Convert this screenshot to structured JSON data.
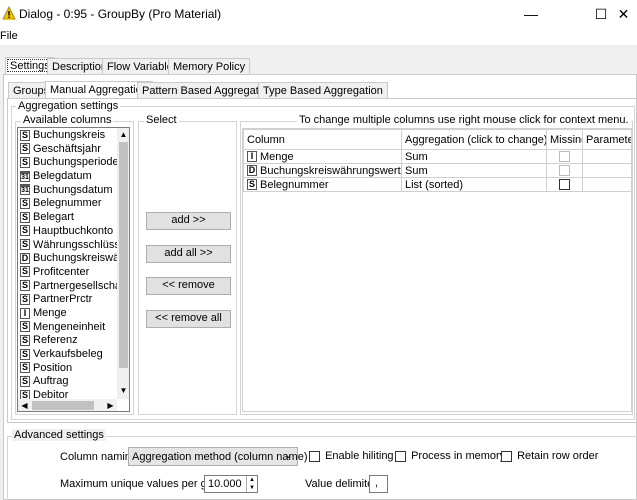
{
  "window": {
    "title": "Dialog - 0:95 - GroupBy (Pro Material)",
    "minimize_glyph": "—",
    "maximize_glyph": "☐",
    "close_glyph": "✕"
  },
  "menu": {
    "file": "File"
  },
  "top_tabs": [
    "Settings",
    "Description",
    "Flow Variables",
    "Memory Policy"
  ],
  "sub_tabs": [
    "Groups",
    "Manual Aggregation",
    "Pattern Based Aggregation",
    "Type Based Aggregation"
  ],
  "aggregation": {
    "section_title": "Aggregation settings",
    "available_title": "Available columns",
    "select_title": "Select",
    "hint": "To change multiple columns use right mouse click for context menu.",
    "columns": [
      {
        "type": "S",
        "name": "Buchungskreis"
      },
      {
        "type": "S",
        "name": "Geschäftsjahr"
      },
      {
        "type": "S",
        "name": "Buchungsperiode"
      },
      {
        "type": "31",
        "name": "Belegdatum"
      },
      {
        "type": "31",
        "name": "Buchungsdatum"
      },
      {
        "type": "S",
        "name": "Belegnummer"
      },
      {
        "type": "S",
        "name": "Belegart"
      },
      {
        "type": "S",
        "name": "Hauptbuchkonto"
      },
      {
        "type": "S",
        "name": "Währungsschlüssel"
      },
      {
        "type": "D",
        "name": "Buchungskreiswähru"
      },
      {
        "type": "S",
        "name": "Profitcenter"
      },
      {
        "type": "S",
        "name": "Partnergesellschaft"
      },
      {
        "type": "S",
        "name": "PartnerPrctr"
      },
      {
        "type": "I",
        "name": "Menge"
      },
      {
        "type": "S",
        "name": "Mengeneinheit"
      },
      {
        "type": "S",
        "name": "Referenz"
      },
      {
        "type": "S",
        "name": "Verkaufsbeleg"
      },
      {
        "type": "S",
        "name": "Position"
      },
      {
        "type": "S",
        "name": "Auftrag"
      },
      {
        "type": "S",
        "name": "Debitor"
      }
    ],
    "buttons": {
      "add": "add >>",
      "add_all": "add all >>",
      "remove": "<< remove",
      "remove_all": "<< remove all"
    },
    "table_headers": [
      "Column",
      "Aggregation (click to change)",
      "Missing",
      "Parameter"
    ],
    "rows": [
      {
        "type": "I",
        "column": "Menge",
        "aggregation": "Sum"
      },
      {
        "type": "D",
        "column": "Buchungskreiswährungswert",
        "aggregation": "Sum"
      },
      {
        "type": "S",
        "column": "Belegnummer",
        "aggregation": "List (sorted)"
      }
    ]
  },
  "advanced": {
    "section_title": "Advanced settings",
    "column_naming_label": "Column naming:",
    "column_naming_value": "Aggregation method (column name)",
    "enable_hiliting": "Enable hiliting",
    "process_in_memory": "Process in memory",
    "retain_row_order": "Retain row order",
    "max_unique_label": "Maximum unique values per group",
    "max_unique_value": "10.000",
    "value_delimiter_label": "Value delimiter",
    "value_delimiter_value": ","
  }
}
